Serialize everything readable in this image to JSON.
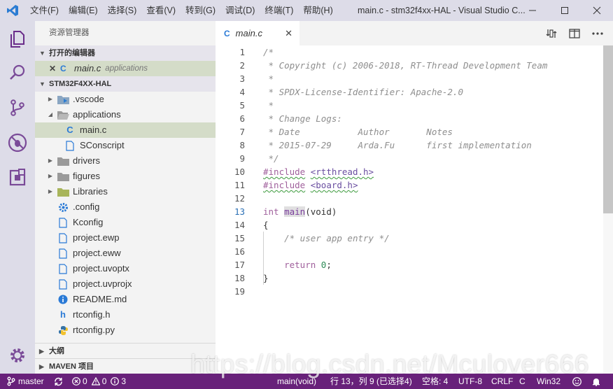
{
  "titlebar": {
    "menu": [
      "文件(F)",
      "编辑(E)",
      "选择(S)",
      "查看(V)",
      "转到(G)",
      "调试(D)",
      "终端(T)",
      "帮助(H)"
    ],
    "window_title": "main.c - stm32f4xx-HAL - Visual Studio C..."
  },
  "activitybar": {
    "icons": [
      "explorer-icon",
      "search-icon",
      "source-control-icon",
      "debug-icon",
      "extensions-icon",
      "settings-gear-icon"
    ]
  },
  "sidebar": {
    "title": "资源管理器",
    "open_editors": {
      "header": "打开的编辑器",
      "items": [
        {
          "close": "✕",
          "icon": "C",
          "name": "main.c",
          "folder": "applications"
        }
      ]
    },
    "project": {
      "header": "STM32F4XX-HAL",
      "items": [
        {
          "name": ".vscode",
          "type": "folder",
          "icon": "vscode-folder-icon"
        },
        {
          "name": "applications",
          "type": "folder-open",
          "icon": "folder-open-icon"
        },
        {
          "name": "main.c",
          "type": "file",
          "icon": "c-file-icon",
          "glyph": "C"
        },
        {
          "name": "SConscript",
          "type": "file",
          "icon": "file-icon"
        },
        {
          "name": "drivers",
          "type": "folder",
          "icon": "folder-icon"
        },
        {
          "name": "figures",
          "type": "folder",
          "icon": "folder-icon"
        },
        {
          "name": "Libraries",
          "type": "folder",
          "icon": "libraries-folder-icon"
        },
        {
          "name": ".config",
          "type": "file",
          "icon": "config-gear-icon"
        },
        {
          "name": "Kconfig",
          "type": "file",
          "icon": "file-icon"
        },
        {
          "name": "project.ewp",
          "type": "file",
          "icon": "file-icon"
        },
        {
          "name": "project.eww",
          "type": "file",
          "icon": "file-icon"
        },
        {
          "name": "project.uvoptx",
          "type": "file",
          "icon": "file-icon"
        },
        {
          "name": "project.uvprojx",
          "type": "file",
          "icon": "file-icon"
        },
        {
          "name": "README.md",
          "type": "file",
          "icon": "info-icon"
        },
        {
          "name": "rtconfig.h",
          "type": "file",
          "icon": "h-file-icon",
          "glyph": "h"
        },
        {
          "name": "rtconfig.py",
          "type": "file",
          "icon": "python-icon"
        }
      ]
    },
    "outline_header": "大纲",
    "maven_header": "MAVEN 项目"
  },
  "editor": {
    "tab": {
      "label": "main.c",
      "icon": "C",
      "close": "✕"
    },
    "line_numbers": [
      "1",
      "2",
      "3",
      "4",
      "5",
      "6",
      "7",
      "8",
      "9",
      "10",
      "11",
      "12",
      "13",
      "14",
      "15",
      "16",
      "17",
      "18",
      "19"
    ],
    "active_line": "13",
    "code": {
      "l1": "/*",
      "l2": " * Copyright (c) 2006-2018, RT-Thread Development Team",
      "l3": " *",
      "l4": " * SPDX-License-Identifier: Apache-2.0",
      "l5": " *",
      "l6": " * Change Logs:",
      "l7": " * Date           Author       Notes",
      "l8": " * 2015-07-29     Arda.Fu      first implementation",
      "l9": " */",
      "l10_kw": "#include",
      "l10_str": "<rtthread.h>",
      "l11_kw": "#include",
      "l11_str": "<board.h>",
      "l13_type": "int",
      "l13_fn": "main",
      "l13_args": "(void)",
      "l14": "{",
      "l15": "/* user app entry */",
      "l17_kw": "return",
      "l17_num": "0",
      "l17_semi": ";",
      "l18": "}"
    }
  },
  "statusbar": {
    "branch": "master",
    "errors": "0",
    "warnings": "0",
    "infos": "3",
    "scope": "main(void)",
    "position": "行 13，列 9 (已选择4)",
    "spaces": "空格: 4",
    "encoding": "UTF-8",
    "eol": "CRLF",
    "language": "C",
    "platform": "Win32"
  },
  "watermark": "https://blog.csdn.net/Mculover666",
  "colors": {
    "statusbar": "#68217a",
    "chrome": "#dddce8",
    "sidebar": "#f3f3f3",
    "selection": "#d4dcc8"
  }
}
